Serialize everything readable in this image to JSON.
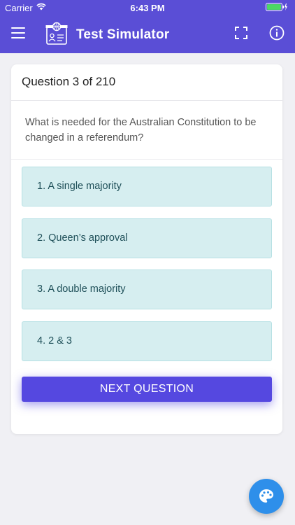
{
  "status": {
    "carrier": "Carrier",
    "time": "6:43 PM"
  },
  "header": {
    "title": "Test Simulator",
    "icons": [
      "menu-icon",
      "id-card-globe-icon",
      "fullscreen-icon",
      "info-icon"
    ]
  },
  "question": {
    "counter": "Question 3 of 210",
    "text": "What is needed for the Australian Constitution to be changed in a referendum?"
  },
  "answers": [
    {
      "label": "1. A single majority"
    },
    {
      "label": "2. Queen’s approval"
    },
    {
      "label": "3. A double majority"
    },
    {
      "label": "4. 2 & 3"
    }
  ],
  "next_button_label": "NEXT QUESTION",
  "fab_icon": "palette-icon",
  "colors": {
    "header": "#5a4ed6",
    "answer_bg": "#d6eef0",
    "button": "#5548e0",
    "fab": "#2e8fea"
  }
}
